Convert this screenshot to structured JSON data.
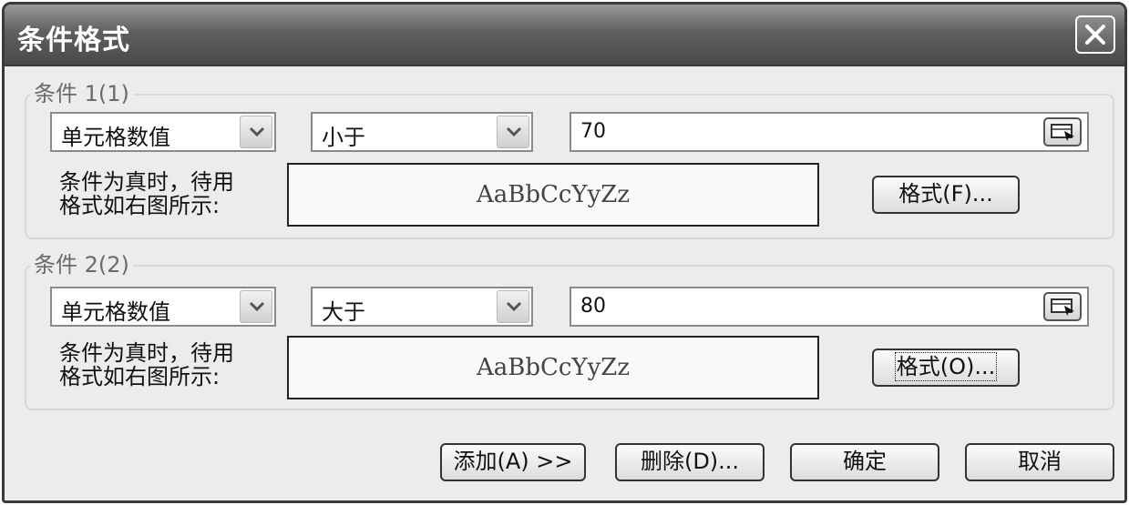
{
  "dialog": {
    "title": "条件格式",
    "close_icon": "close-icon"
  },
  "conditions": [
    {
      "label": "条件 1",
      "shortcut": "(1)",
      "type_value": "单元格数值",
      "operator_value": "小于",
      "value": "70",
      "hint_line1": "条件为真时，待用",
      "hint_line2": "格式如右图所示:",
      "preview_text": "AaBbCcYyZz",
      "format_button": "格式(F)..."
    },
    {
      "label": "条件 2",
      "shortcut": "(2)",
      "type_value": "单元格数值",
      "operator_value": "大于",
      "value": "80",
      "hint_line1": "条件为真时，待用",
      "hint_line2": "格式如右图所示:",
      "preview_text": "AaBbCcYyZz",
      "format_button": "格式(O)..."
    }
  ],
  "footer": {
    "add_button": "添加(A) >>",
    "delete_button": "删除(D)...",
    "ok_button": "确定",
    "cancel_button": "取消"
  }
}
